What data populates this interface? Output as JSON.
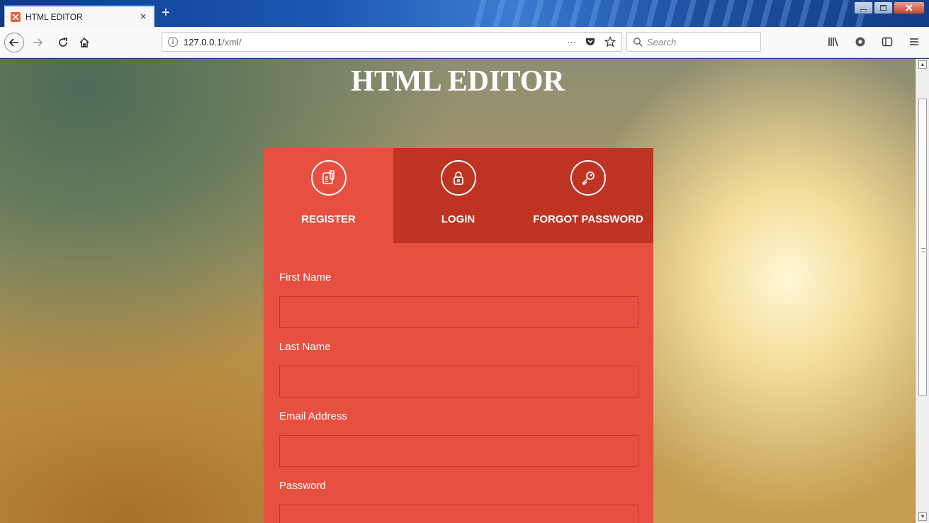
{
  "browser": {
    "tab": {
      "title": "HTML EDITOR",
      "close": "×"
    },
    "new_tab": "+",
    "url": {
      "host": "127.0.0.1",
      "path": "/xml/"
    },
    "url_more": "···",
    "search_placeholder": "Search"
  },
  "page": {
    "heading": "HTML EDITOR",
    "tabs": [
      {
        "label": "REGISTER",
        "icon": "register-form-icon",
        "active": true
      },
      {
        "label": "LOGIN",
        "icon": "lock-icon",
        "active": false
      },
      {
        "label": "FORGOT PASSWORD",
        "icon": "key-icon",
        "active": false
      }
    ],
    "fields": [
      {
        "label": "First Name",
        "value": ""
      },
      {
        "label": "Last Name",
        "value": ""
      },
      {
        "label": "Email Address",
        "value": ""
      },
      {
        "label": "Password",
        "value": ""
      }
    ]
  },
  "colors": {
    "form_active": "#e74f40",
    "form_inactive": "#bf3323",
    "input_border": "#c2392c"
  }
}
